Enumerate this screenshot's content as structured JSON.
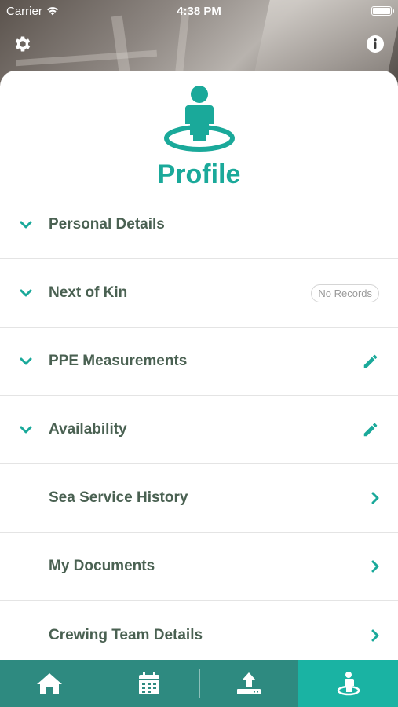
{
  "status_bar": {
    "carrier": "Carrier",
    "time": "4:38 PM"
  },
  "header": {
    "settings_icon": "gear-icon",
    "info_icon": "info-icon"
  },
  "profile": {
    "title": "Profile",
    "icon": "person-pin-icon",
    "accent": "#1aa99a"
  },
  "sections": [
    {
      "label": "Personal Details",
      "expander": "chevron-down-icon",
      "right": ""
    },
    {
      "label": "Next of Kin",
      "expander": "chevron-down-icon",
      "badge": "No Records"
    },
    {
      "label": "PPE Measurements",
      "expander": "chevron-down-icon",
      "right": "pencil-icon"
    },
    {
      "label": "Availability",
      "expander": "chevron-down-icon",
      "right": "pencil-icon"
    },
    {
      "label": "Sea Service History",
      "right": "chevron-right-icon"
    },
    {
      "label": "My Documents",
      "right": "chevron-right-icon"
    },
    {
      "label": "Crewing Team Details",
      "right": "chevron-right-icon"
    }
  ],
  "tabbar": {
    "background": "#2e8a80",
    "active_background": "#1ab3a3",
    "tabs": [
      {
        "icon": "home-icon",
        "active": false
      },
      {
        "icon": "calendar-icon",
        "active": false
      },
      {
        "icon": "upload-icon",
        "active": false
      },
      {
        "icon": "profile-icon",
        "active": true
      }
    ]
  }
}
